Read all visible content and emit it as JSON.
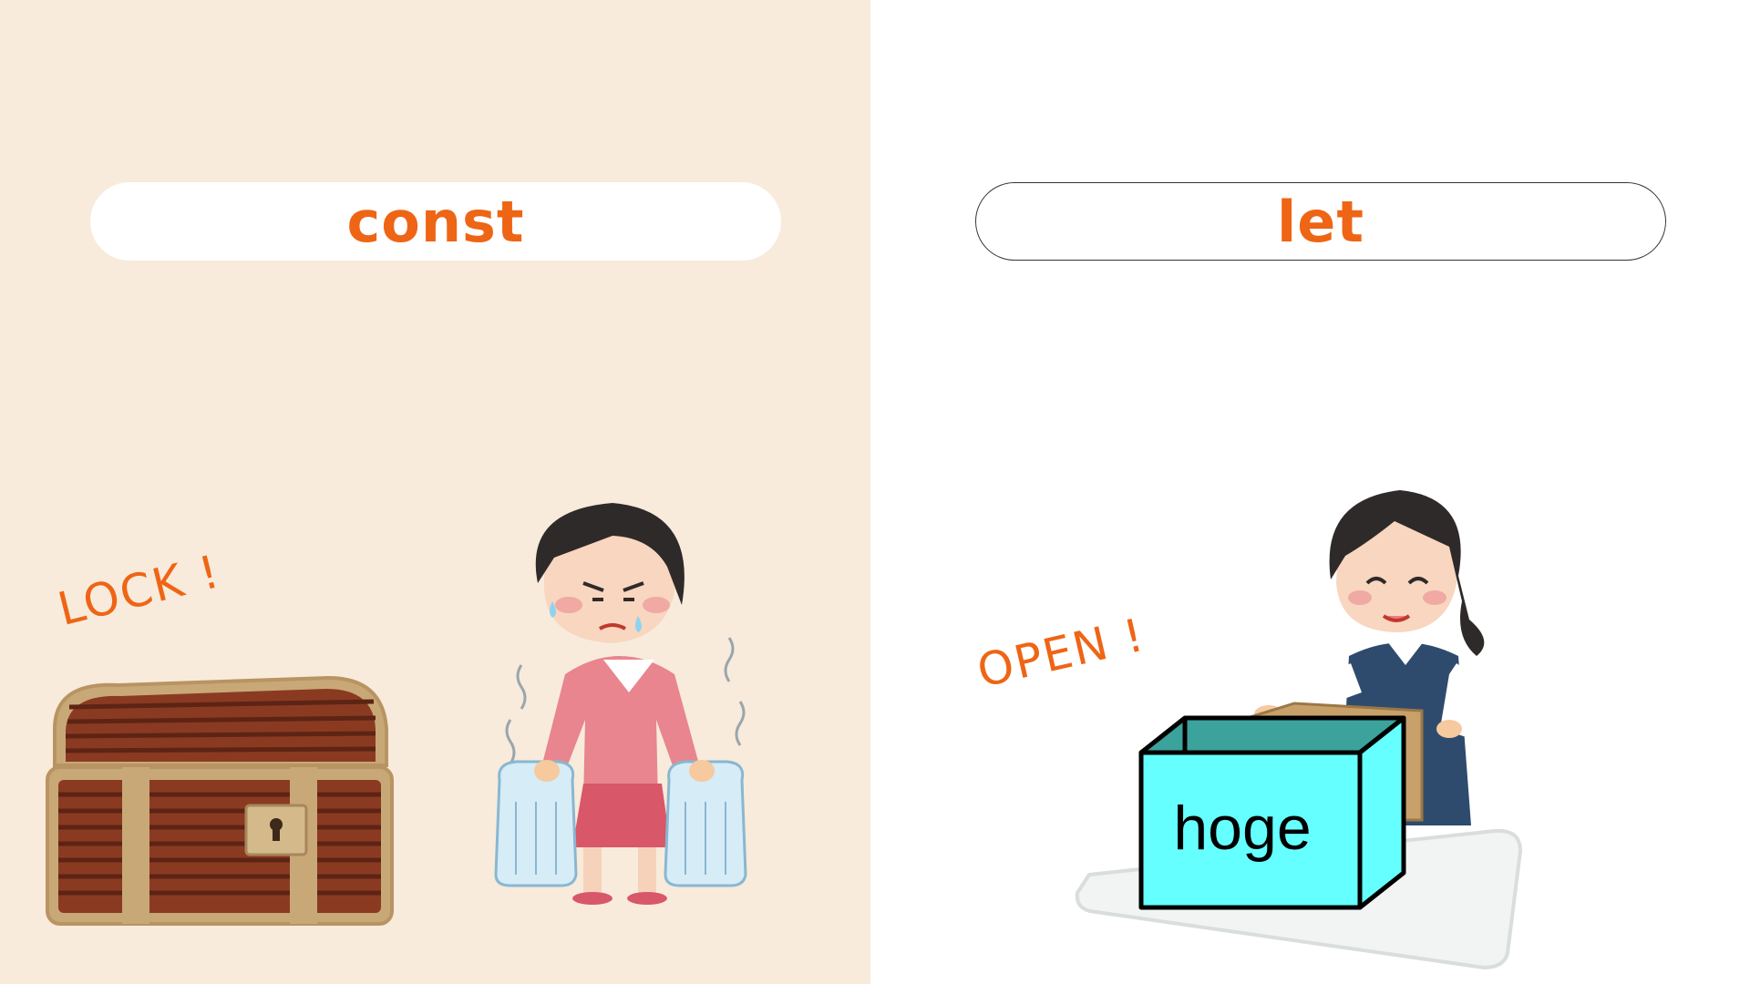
{
  "panels": {
    "const": {
      "title": "const",
      "tag": "LOCK !"
    },
    "let": {
      "title": "let",
      "tag": "OPEN !",
      "box_label": "hoge"
    }
  },
  "colors": {
    "accent": "#ee6515",
    "left_background": "#f8ebdb",
    "box": "#66ffff"
  },
  "icons": [
    "treasure-chest-icon",
    "woman-carrying-water-bottles-icon",
    "woman-opening-box-icon"
  ]
}
